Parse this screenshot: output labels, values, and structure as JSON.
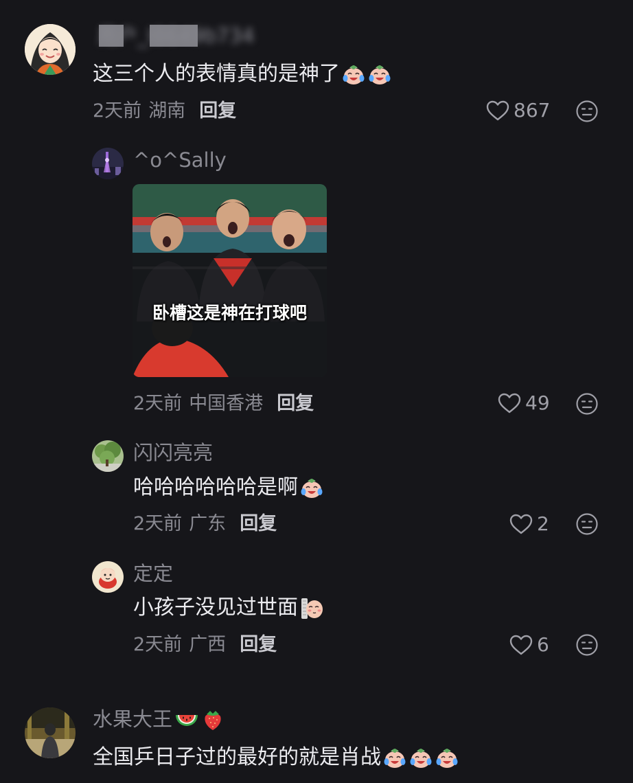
{
  "comments": [
    {
      "username": "用户_I8649b734",
      "content": "这三个人的表情真的是神了",
      "emoji_count": 2,
      "time": "2天前",
      "location": "湖南",
      "reply_label": "回复",
      "likes": "867"
    },
    {
      "username": "^o^Sally",
      "meme_caption": "卧槽这是神在打球吧",
      "time": "2天前",
      "location": "中国香港",
      "reply_label": "回复",
      "likes": "49"
    },
    {
      "username": "闪闪亮亮",
      "content": "哈哈哈哈哈哈是啊",
      "time": "2天前",
      "location": "广东",
      "reply_label": "回复",
      "likes": "2"
    },
    {
      "username": "定定",
      "content": "小孩子没见过世面",
      "time": "2天前",
      "location": "广西",
      "reply_label": "回复",
      "likes": "6"
    },
    {
      "username": "水果大王",
      "content": "全国乒日子过的最好的就是肖战"
    }
  ],
  "icons": {
    "like": "heart-outline-icon",
    "dislike": "meh-face-icon",
    "laugh_cry": "laugh-cry-emoji",
    "shy": "shy-peek-emoji",
    "watermelon": "watermelon-emoji",
    "strawberry": "strawberry-emoji"
  },
  "colors": {
    "background": "#16161a",
    "text_primary": "#ececf0",
    "text_secondary": "#8a8a92"
  }
}
